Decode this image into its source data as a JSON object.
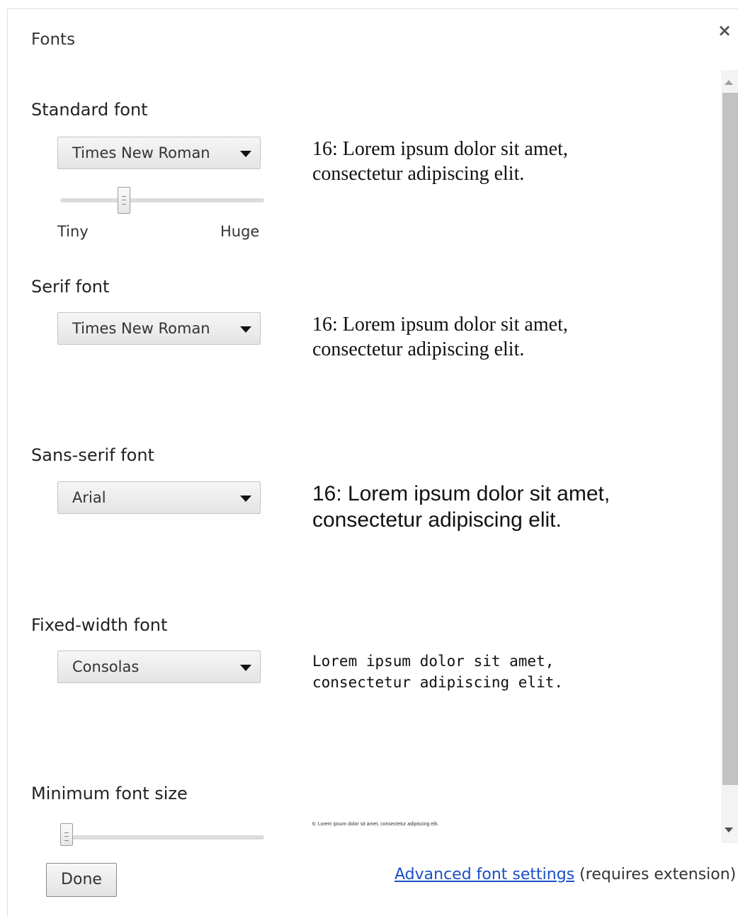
{
  "dialog": {
    "title": "Fonts",
    "close_label": "×"
  },
  "standard": {
    "label": "Standard font",
    "selected": "Times New Roman",
    "size_slider": {
      "min_label": "Tiny",
      "max_label": "Huge",
      "level": 0.3
    },
    "preview": "16: Lorem ipsum dolor sit amet, consectetur adipiscing elit."
  },
  "serif": {
    "label": "Serif font",
    "selected": "Times New Roman",
    "preview": "16: Lorem ipsum dolor sit amet, consectetur adipiscing elit."
  },
  "sans": {
    "label": "Sans-serif font",
    "selected": "Arial",
    "preview": "16: Lorem ipsum dolor sit amet, consectetur adipiscing elit."
  },
  "fixed": {
    "label": "Fixed-width font",
    "selected": "Consolas",
    "preview": "Lorem ipsum dolor sit amet, consectetur adipiscing elit."
  },
  "minimum": {
    "label": "Minimum font size",
    "slider_level": 0.0,
    "preview": "6: Lorem ipsum dolor sit amet, consectetur adipiscing elit."
  },
  "footer": {
    "done_label": "Done",
    "advanced_link": "Advanced font settings",
    "advanced_note": "(requires extension)"
  },
  "colors": {
    "link": "#1a4fc7",
    "scrollbar_thumb": "#c2c2c2"
  }
}
